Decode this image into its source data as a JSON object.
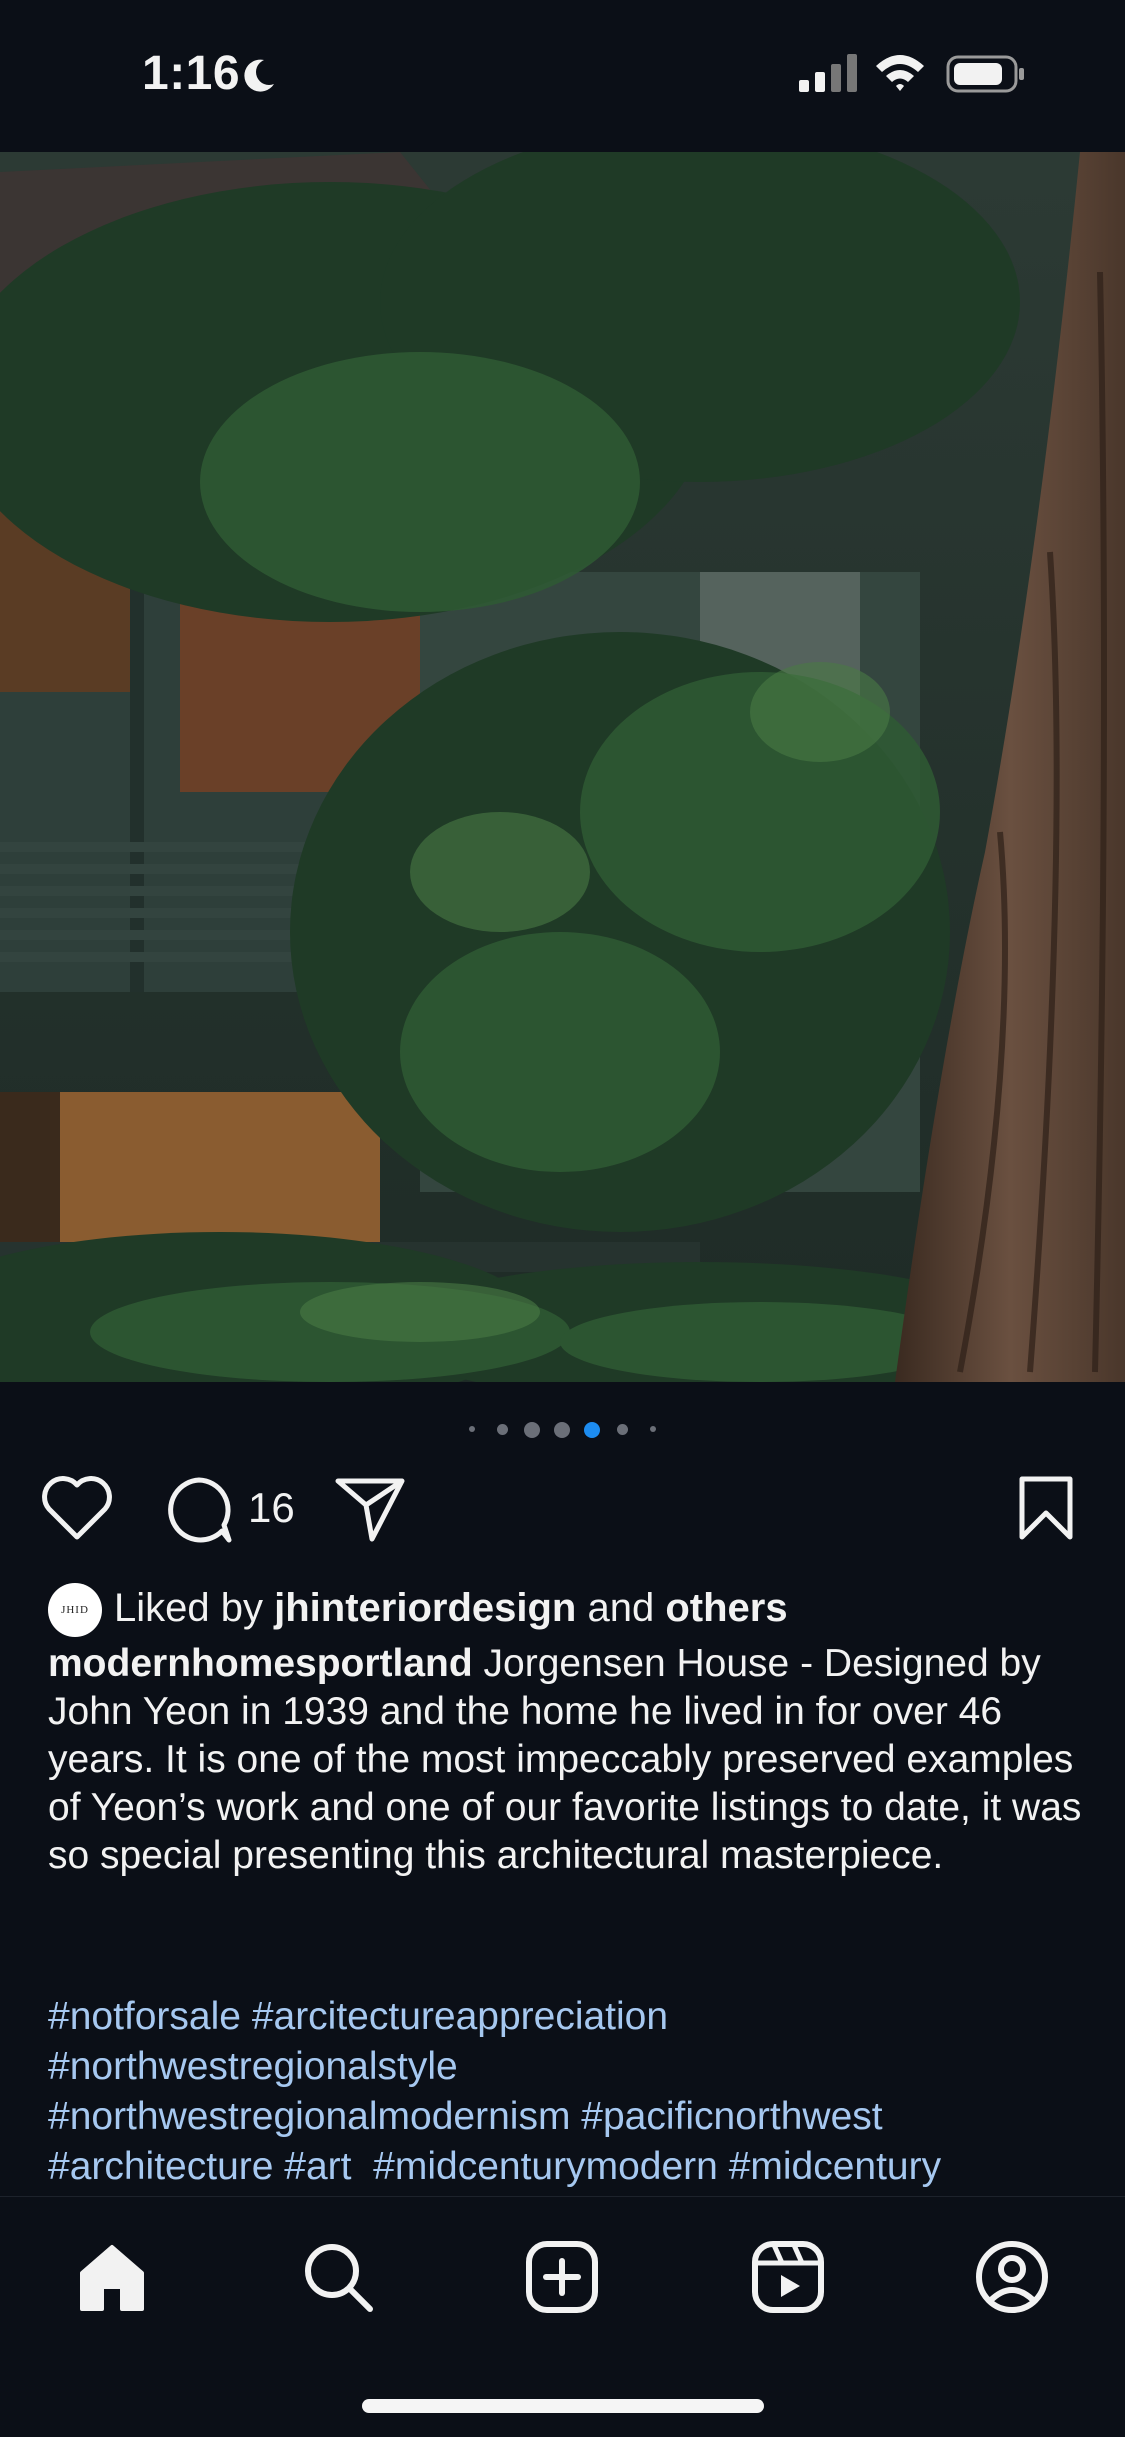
{
  "status_bar": {
    "time": "1:16",
    "icons": [
      "moon-icon",
      "signal-icon",
      "wifi-icon",
      "battery-icon"
    ]
  },
  "post": {
    "image_alt_icon": "photo",
    "carousel": {
      "dot_count": 7,
      "active_index": 4
    },
    "actions": {
      "comment_count": "16",
      "icons": [
        "heart-icon",
        "comment-icon",
        "share-icon",
        "bookmark-icon"
      ]
    },
    "liked_by": {
      "avatar_text": "JHID",
      "prefix": "Liked by",
      "user": "jhinteriordesign",
      "conj": "and",
      "others": "others"
    },
    "caption": {
      "username": "modernhomesportland",
      "text": "Jorgensen House - Designed by John Yeon in 1939 and the home he lived in for over 46 years. It is one of the most impeccably preserved examples of Yeon’s work and one of our favorite listings to date, it was so special presenting this architectural masterpiece."
    },
    "hashtags": [
      "#notforsale",
      "#arcitectureappreciation",
      "#northwestregionalstyle",
      "#northwestregionalmodernism",
      "#pacificnorthwest",
      "#architecture",
      "#art",
      "#midcenturymodern",
      "#midcentury"
    ]
  },
  "bottom_nav": {
    "items": [
      "home-icon",
      "search-icon",
      "create-icon",
      "reels-icon",
      "profile-icon"
    ]
  },
  "colors": {
    "background": "#0b0f17",
    "hashtag": "#a6c8f0",
    "active_dot": "#1d8cf0"
  }
}
